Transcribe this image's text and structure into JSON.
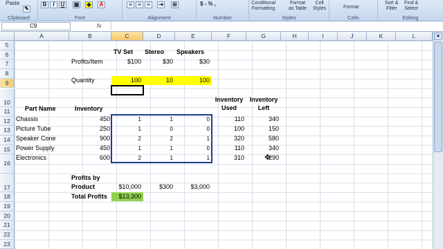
{
  "ribbon": {
    "paste": "Paste",
    "groups": [
      "Clipboard",
      "Font",
      "Alignment",
      "Number",
      "Styles",
      "Cells",
      "Editing"
    ],
    "currency": "$ - % ,",
    "cond_fmt": "Conditional",
    "cond_fmt2": "Formatting",
    "fmt_table": "Format",
    "fmt_table2": "as Table",
    "cell_styles": "Cell",
    "cell_styles2": "Styles",
    "format": "Format",
    "sort": "Sort &",
    "sort2": "Filter",
    "find": "Find &",
    "find2": "Select"
  },
  "formula": {
    "namebox": "C9",
    "fx": "fx",
    "value": ""
  },
  "columns": [
    "A",
    "B",
    "C",
    "D",
    "E",
    "F",
    "G",
    "H",
    "I",
    "J",
    "K",
    "L"
  ],
  "rows": [
    "5",
    "6",
    "7",
    "8",
    "9",
    "10",
    "11",
    "12",
    "13",
    "14",
    "15",
    "16",
    "17",
    "18",
    "19",
    "20",
    "21",
    "22",
    "23"
  ],
  "cells": {
    "tv": "TV Set",
    "stereo": "Stereo",
    "speakers": "Speakers",
    "profits_item": "Profits/Item",
    "p_c": "$100",
    "p_d": "$30",
    "p_e": "$30",
    "quantity": "Quantity",
    "q_c": "100",
    "q_d": "10",
    "q_e": "100",
    "inv_used1": "Inventory",
    "inv_used2": "Used",
    "inv_left1": "Inventory",
    "inv_left2": "Left",
    "part_name": "Part Name",
    "inventory": "Inventory",
    "parts": [
      {
        "name": "Chassis",
        "inv": "450",
        "c": "1",
        "d": "1",
        "e": "0",
        "used": "110",
        "left": "340"
      },
      {
        "name": "Picture Tube",
        "inv": "250",
        "c": "1",
        "d": "0",
        "e": "0",
        "used": "100",
        "left": "150"
      },
      {
        "name": "Speaker Cone",
        "inv": "900",
        "c": "2",
        "d": "2",
        "e": "1",
        "used": "320",
        "left": "580"
      },
      {
        "name": "Power Supply",
        "inv": "450",
        "c": "1",
        "d": "1",
        "e": "0",
        "used": "110",
        "left": "340"
      },
      {
        "name": "Electronics",
        "inv": "600",
        "c": "2",
        "d": "1",
        "e": "1",
        "used": "310",
        "left": "290"
      }
    ],
    "profits_by1": "Profits by",
    "profits_by2": "Product",
    "pb_c": "$10,000",
    "pb_d": "$300",
    "pb_e": "$3,000",
    "total_profits": "Total Profits",
    "total_c": "$13,300"
  },
  "colors": {
    "yellow": "#ffff00",
    "green": "#92d050",
    "range_border": "#1f3a8a"
  }
}
